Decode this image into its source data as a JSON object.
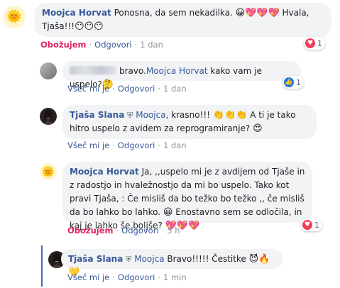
{
  "comments": [
    {
      "avatar_icon": "sun-icon",
      "avatar_glyph": "🌞",
      "author": "Moojca Horvat",
      "text_a": " Ponosna, da sem nekadilka. ",
      "emoji_a": "😀💖💖💖",
      "text_b": " Hvala, Tjaša!!!",
      "emoji_b": "😶😶😶",
      "like_label": "Obožujem",
      "reply_label": "Odgovori",
      "time": "1 dan",
      "reaction_count": "1"
    },
    {
      "avatar_icon": "blurred-avatar",
      "author_blurred": true,
      "text_a": "bravo.",
      "mention": "Moojca Horvat",
      "text_b": " kako vam je uspelo?",
      "emoji_a": "🤔",
      "like_label": "Všeč mi je",
      "reply_label": "Odgovori",
      "time": "1 dan",
      "reaction_count": "1"
    },
    {
      "avatar_icon": "profile-photo",
      "author": "Tjaša Slana",
      "guard_icon": "shield-icon",
      "mention": "Moojca",
      "text_a": ", krasno!!! ",
      "emoji_a": "👏👏👏",
      "text_b": " A ti je tako hitro uspelo z avidem za reprogramiranje? ",
      "emoji_b": "😍",
      "like_label": "Všeč mi je",
      "reply_label": "Odgovori",
      "time": "1 dan"
    },
    {
      "avatar_icon": "sun-icon",
      "avatar_glyph": "🌞",
      "author": "Moojca Horvat",
      "text_a": " Ja, ,,uspelo mi je z avdijem od Tjaše in z radostjo in hvaležnostjo da mi bo uspelo. Tako kot pravi Tjaša, : Če misliš da bo težko bo težko ,, če misliš da bo lahko bo lahko. ",
      "emoji_a": "😀",
      "text_b": " Enostavno sem se odločila, in kaj je lahko še boljše? ",
      "emoji_b": "💖💖💖",
      "like_label": "Obožujem",
      "reply_label": "Odgovori",
      "time": "5 h",
      "reaction_count": "1"
    },
    {
      "avatar_icon": "profile-photo",
      "author": "Tjaša Slana",
      "guard_icon": "shield-icon",
      "mention": "Moojca",
      "text_a": " Bravo!!!!! Čestitke ",
      "emoji_a": "😈🔥💛",
      "like_label": "Všeč mi je",
      "reply_label": "Odgovori",
      "time": "1 min"
    }
  ],
  "colors": {
    "link": "#385898",
    "love": "#e0245e",
    "bubble": "#f2f3f5",
    "thread_line": "#4267b2"
  }
}
